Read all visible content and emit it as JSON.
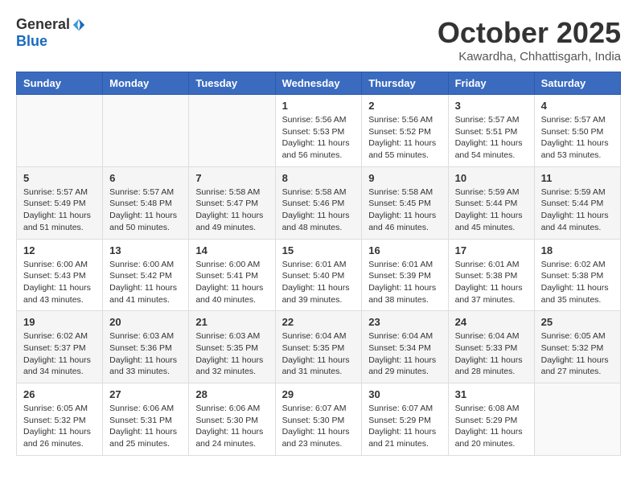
{
  "logo": {
    "general": "General",
    "blue": "Blue"
  },
  "title": "October 2025",
  "location": "Kawardha, Chhattisgarh, India",
  "weekdays": [
    "Sunday",
    "Monday",
    "Tuesday",
    "Wednesday",
    "Thursday",
    "Friday",
    "Saturday"
  ],
  "rows": [
    [
      {
        "day": "",
        "info": ""
      },
      {
        "day": "",
        "info": ""
      },
      {
        "day": "",
        "info": ""
      },
      {
        "day": "1",
        "info": "Sunrise: 5:56 AM\nSunset: 5:53 PM\nDaylight: 11 hours and 56 minutes."
      },
      {
        "day": "2",
        "info": "Sunrise: 5:56 AM\nSunset: 5:52 PM\nDaylight: 11 hours and 55 minutes."
      },
      {
        "day": "3",
        "info": "Sunrise: 5:57 AM\nSunset: 5:51 PM\nDaylight: 11 hours and 54 minutes."
      },
      {
        "day": "4",
        "info": "Sunrise: 5:57 AM\nSunset: 5:50 PM\nDaylight: 11 hours and 53 minutes."
      }
    ],
    [
      {
        "day": "5",
        "info": "Sunrise: 5:57 AM\nSunset: 5:49 PM\nDaylight: 11 hours and 51 minutes."
      },
      {
        "day": "6",
        "info": "Sunrise: 5:57 AM\nSunset: 5:48 PM\nDaylight: 11 hours and 50 minutes."
      },
      {
        "day": "7",
        "info": "Sunrise: 5:58 AM\nSunset: 5:47 PM\nDaylight: 11 hours and 49 minutes."
      },
      {
        "day": "8",
        "info": "Sunrise: 5:58 AM\nSunset: 5:46 PM\nDaylight: 11 hours and 48 minutes."
      },
      {
        "day": "9",
        "info": "Sunrise: 5:58 AM\nSunset: 5:45 PM\nDaylight: 11 hours and 46 minutes."
      },
      {
        "day": "10",
        "info": "Sunrise: 5:59 AM\nSunset: 5:44 PM\nDaylight: 11 hours and 45 minutes."
      },
      {
        "day": "11",
        "info": "Sunrise: 5:59 AM\nSunset: 5:44 PM\nDaylight: 11 hours and 44 minutes."
      }
    ],
    [
      {
        "day": "12",
        "info": "Sunrise: 6:00 AM\nSunset: 5:43 PM\nDaylight: 11 hours and 43 minutes."
      },
      {
        "day": "13",
        "info": "Sunrise: 6:00 AM\nSunset: 5:42 PM\nDaylight: 11 hours and 41 minutes."
      },
      {
        "day": "14",
        "info": "Sunrise: 6:00 AM\nSunset: 5:41 PM\nDaylight: 11 hours and 40 minutes."
      },
      {
        "day": "15",
        "info": "Sunrise: 6:01 AM\nSunset: 5:40 PM\nDaylight: 11 hours and 39 minutes."
      },
      {
        "day": "16",
        "info": "Sunrise: 6:01 AM\nSunset: 5:39 PM\nDaylight: 11 hours and 38 minutes."
      },
      {
        "day": "17",
        "info": "Sunrise: 6:01 AM\nSunset: 5:38 PM\nDaylight: 11 hours and 37 minutes."
      },
      {
        "day": "18",
        "info": "Sunrise: 6:02 AM\nSunset: 5:38 PM\nDaylight: 11 hours and 35 minutes."
      }
    ],
    [
      {
        "day": "19",
        "info": "Sunrise: 6:02 AM\nSunset: 5:37 PM\nDaylight: 11 hours and 34 minutes."
      },
      {
        "day": "20",
        "info": "Sunrise: 6:03 AM\nSunset: 5:36 PM\nDaylight: 11 hours and 33 minutes."
      },
      {
        "day": "21",
        "info": "Sunrise: 6:03 AM\nSunset: 5:35 PM\nDaylight: 11 hours and 32 minutes."
      },
      {
        "day": "22",
        "info": "Sunrise: 6:04 AM\nSunset: 5:35 PM\nDaylight: 11 hours and 31 minutes."
      },
      {
        "day": "23",
        "info": "Sunrise: 6:04 AM\nSunset: 5:34 PM\nDaylight: 11 hours and 29 minutes."
      },
      {
        "day": "24",
        "info": "Sunrise: 6:04 AM\nSunset: 5:33 PM\nDaylight: 11 hours and 28 minutes."
      },
      {
        "day": "25",
        "info": "Sunrise: 6:05 AM\nSunset: 5:32 PM\nDaylight: 11 hours and 27 minutes."
      }
    ],
    [
      {
        "day": "26",
        "info": "Sunrise: 6:05 AM\nSunset: 5:32 PM\nDaylight: 11 hours and 26 minutes."
      },
      {
        "day": "27",
        "info": "Sunrise: 6:06 AM\nSunset: 5:31 PM\nDaylight: 11 hours and 25 minutes."
      },
      {
        "day": "28",
        "info": "Sunrise: 6:06 AM\nSunset: 5:30 PM\nDaylight: 11 hours and 24 minutes."
      },
      {
        "day": "29",
        "info": "Sunrise: 6:07 AM\nSunset: 5:30 PM\nDaylight: 11 hours and 23 minutes."
      },
      {
        "day": "30",
        "info": "Sunrise: 6:07 AM\nSunset: 5:29 PM\nDaylight: 11 hours and 21 minutes."
      },
      {
        "day": "31",
        "info": "Sunrise: 6:08 AM\nSunset: 5:29 PM\nDaylight: 11 hours and 20 minutes."
      },
      {
        "day": "",
        "info": ""
      }
    ]
  ]
}
